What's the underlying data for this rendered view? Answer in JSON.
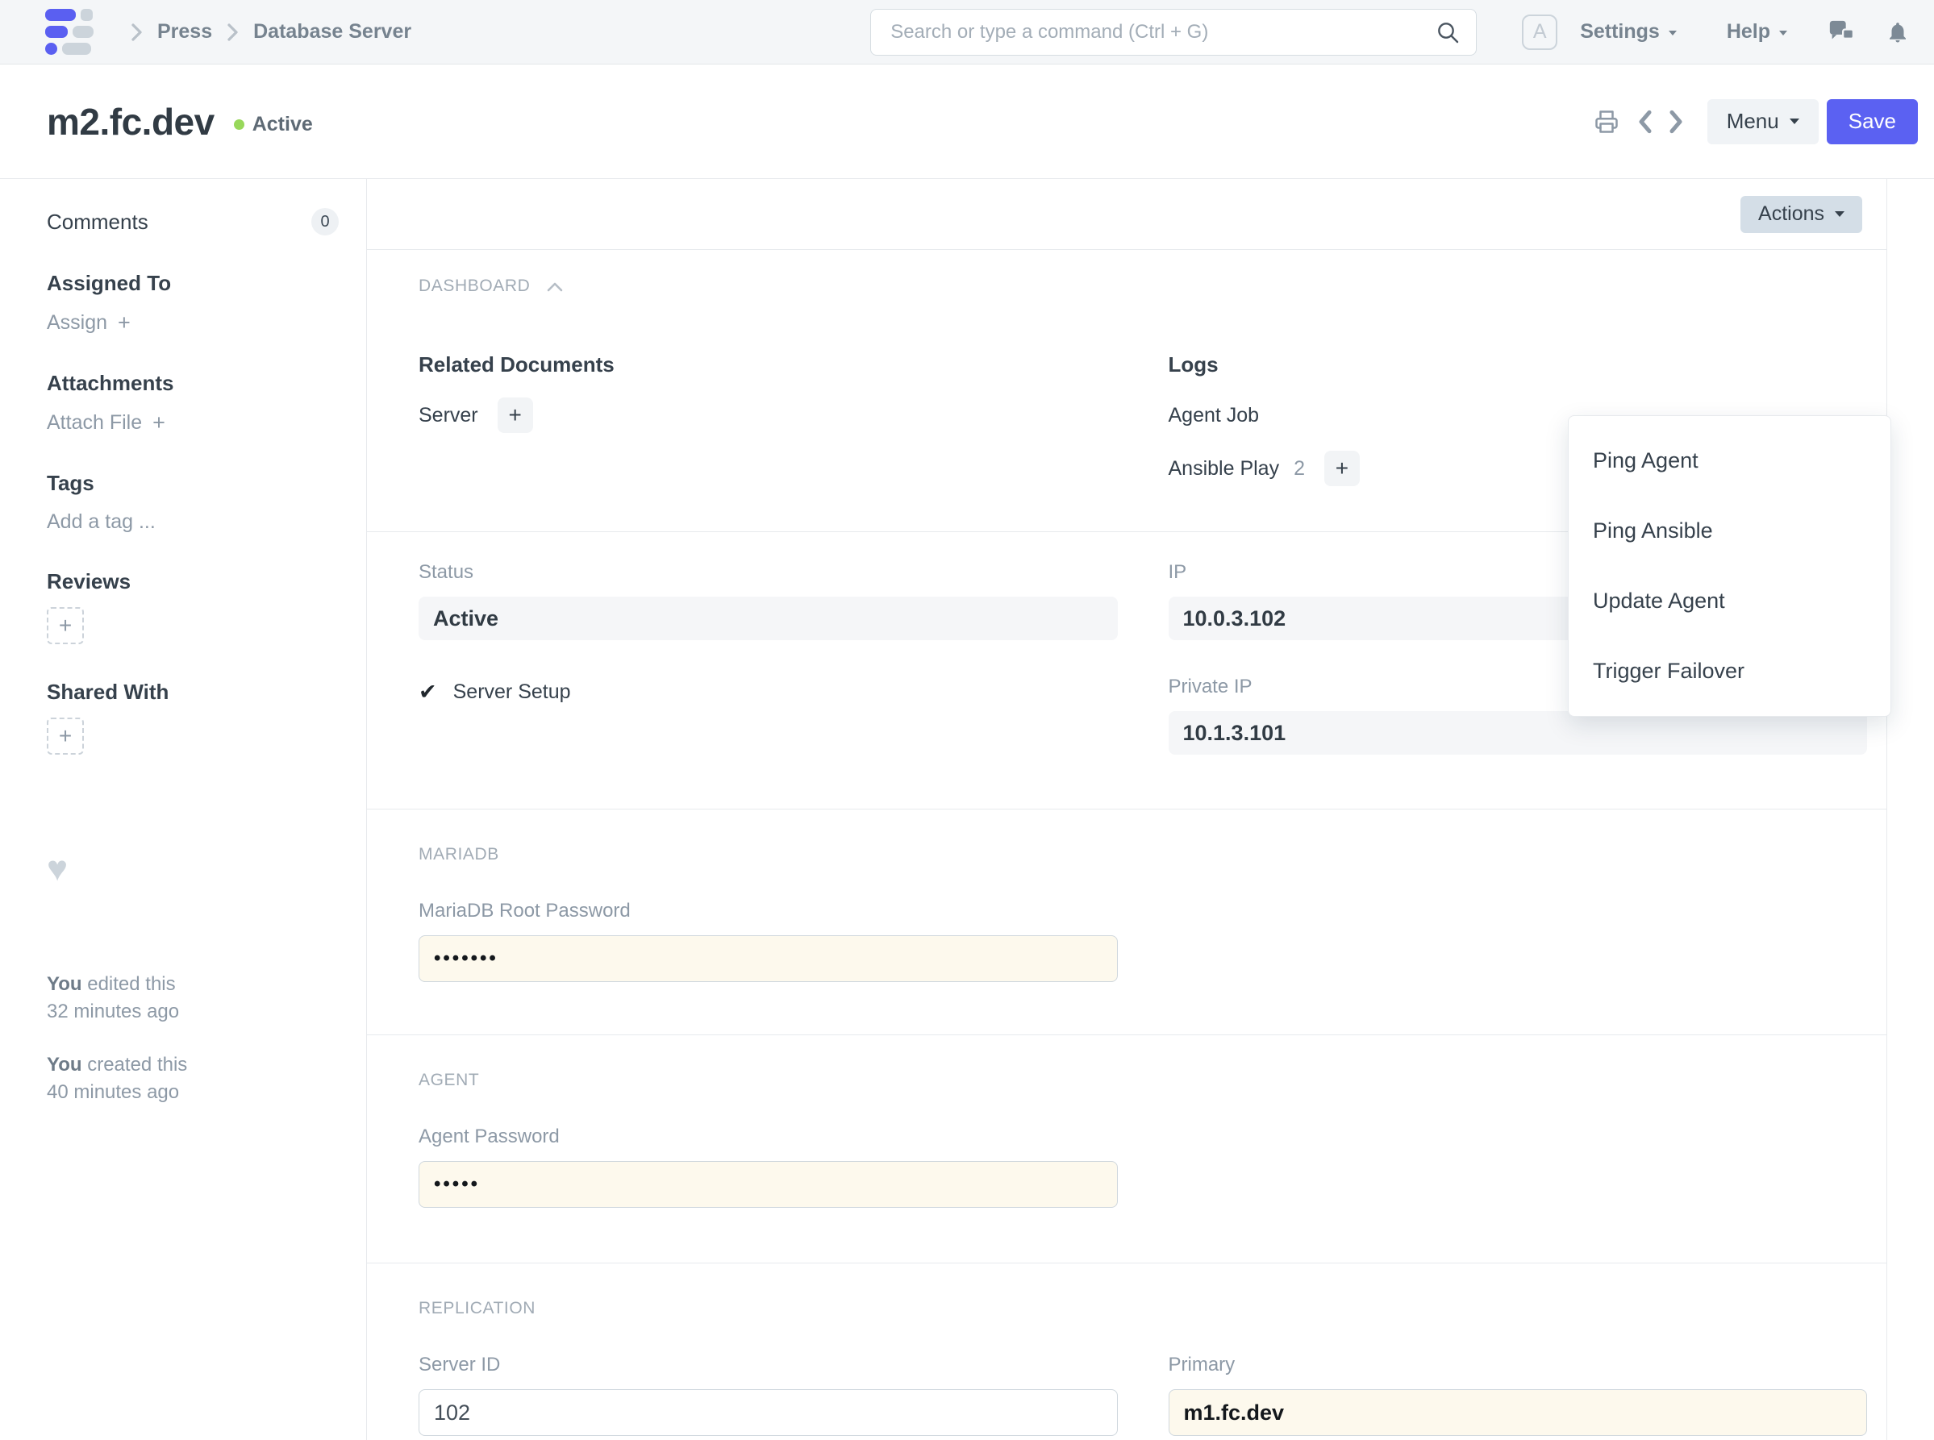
{
  "navbar": {
    "breadcrumbs": {
      "level1": "Press",
      "level2": "Database Server"
    },
    "search_placeholder": "Search or type a command (Ctrl + G)",
    "avatar_letter": "A",
    "settings_label": "Settings",
    "help_label": "Help"
  },
  "page_head": {
    "title": "m2.fc.dev",
    "status_indicator": "Active",
    "menu_label": "Menu",
    "save_label": "Save"
  },
  "sidebar": {
    "comments_label": "Comments",
    "comments_count": "0",
    "assigned_to_label": "Assigned To",
    "assign_label": "Assign",
    "attachments_label": "Attachments",
    "attach_file_label": "Attach File",
    "tags_label": "Tags",
    "add_tag_placeholder": "Add a tag ...",
    "reviews_label": "Reviews",
    "shared_with_label": "Shared With",
    "edited": {
      "who": "You",
      "action": "edited this",
      "when": "32 minutes ago"
    },
    "created": {
      "who": "You",
      "action": "created this",
      "when": "40 minutes ago"
    }
  },
  "actions_menu": {
    "button_label": "Actions",
    "items": [
      "Ping Agent",
      "Ping Ansible",
      "Update Agent",
      "Trigger Failover"
    ]
  },
  "dashboard": {
    "heading": "DASHBOARD",
    "related_documents": {
      "title": "Related Documents",
      "items": [
        {
          "label": "Server"
        }
      ]
    },
    "logs": {
      "title": "Logs",
      "items": [
        {
          "label": "Agent Job",
          "count": ""
        },
        {
          "label": "Ansible Play",
          "count": "2"
        }
      ]
    }
  },
  "form": {
    "status": {
      "label": "Status",
      "value": "Active"
    },
    "server_setup": {
      "label": "Server Setup"
    },
    "ip": {
      "label": "IP",
      "value": "10.0.3.102"
    },
    "private_ip": {
      "label": "Private IP",
      "value": "10.1.3.101"
    },
    "mariadb_section": "MARIADB",
    "mariadb_root_password": {
      "label": "MariaDB Root Password",
      "value": "•••••••"
    },
    "agent_section": "AGENT",
    "agent_password": {
      "label": "Agent Password",
      "value": "•••••"
    },
    "replication_section": "REPLICATION",
    "server_id": {
      "label": "Server ID",
      "value": "102"
    },
    "primary": {
      "label": "Primary",
      "value": "m1.fc.dev"
    }
  },
  "icons": {
    "plus": "+",
    "check": "✔",
    "heart": "♥"
  },
  "colors": {
    "accent": "#5b61f2",
    "active_green": "#98d85b",
    "changed_field_bg": "#fdf9ed",
    "readonly_field_bg": "#f5f6f8",
    "actions_button_bg": "#d4dee7",
    "navbar_bg": "#f4f6f8"
  }
}
